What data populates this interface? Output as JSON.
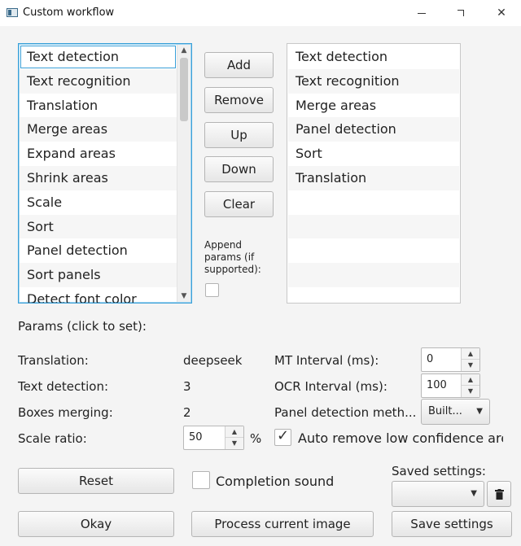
{
  "window": {
    "title": "Custom workflow",
    "icon": "app-window-icon",
    "controls": [
      "minimize-icon",
      "maximize-icon",
      "close-icon"
    ]
  },
  "available_steps": [
    "Text detection",
    "Text recognition",
    "Translation",
    "Merge areas",
    "Expand areas",
    "Shrink areas",
    "Scale",
    "Sort",
    "Panel detection",
    "Sort panels",
    "Detect font color"
  ],
  "selected_available": "Text detection",
  "workflow_steps": [
    "Text detection",
    "Text recognition",
    "Merge areas",
    "Panel detection",
    "Sort",
    "Translation"
  ],
  "side_buttons": {
    "add": "Add",
    "remove": "Remove",
    "up": "Up",
    "down": "Down",
    "clear": "Clear"
  },
  "append_params_label": "Append params (if supported):",
  "append_params_checked": false,
  "params": {
    "heading": "Params (click to set):",
    "translation_label": "Translation:",
    "translation_value": "deepseek",
    "text_detection_label": "Text detection:",
    "text_detection_value": "3",
    "boxes_merging_label": "Boxes merging:",
    "boxes_merging_value": "2",
    "scale_ratio_label": "Scale ratio:",
    "scale_ratio_value": "50",
    "scale_ratio_unit": "%",
    "mt_interval_label": "MT Interval (ms):",
    "mt_interval_value": "0",
    "ocr_interval_label": "OCR Interval (ms):",
    "ocr_interval_value": "100",
    "panel_detection_label": "Panel detection meth...",
    "panel_detection_value": "Built...",
    "auto_remove_label": "Auto remove low confidence area",
    "auto_remove_checked": true
  },
  "bottom": {
    "reset": "Reset",
    "completion_sound_label": "Completion sound",
    "completion_sound_checked": false,
    "saved_settings_label": "Saved settings:",
    "saved_settings_value": "",
    "okay": "Okay",
    "process_current_image": "Process current image",
    "save_settings": "Save settings"
  }
}
